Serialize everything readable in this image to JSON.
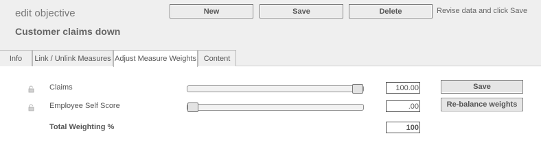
{
  "header": {
    "kicker": "edit objective",
    "objective_name": "Customer claims down",
    "hint": "Revise data and click Save"
  },
  "toolbar": {
    "new_label": "New",
    "save_label": "Save",
    "delete_label": "Delete"
  },
  "tabs": [
    {
      "label": "Info"
    },
    {
      "label": "Link / Unlink Measures"
    },
    {
      "label": "Adjust Measure Weights"
    },
    {
      "label": "Content"
    }
  ],
  "active_tab": "Adjust Measure Weights",
  "weights": {
    "rows": [
      {
        "label": "Claims",
        "value": "100.00",
        "slider_percent": 100,
        "lock_icon": "lock-icon"
      },
      {
        "label": "Employee Self Score",
        "value": ".00",
        "slider_percent": 0,
        "lock_icon": "lock-icon"
      }
    ],
    "total_label": "Total Weighting %",
    "total_value": "100",
    "save_label": "Save",
    "rebalance_label": "Re-balance weights"
  }
}
